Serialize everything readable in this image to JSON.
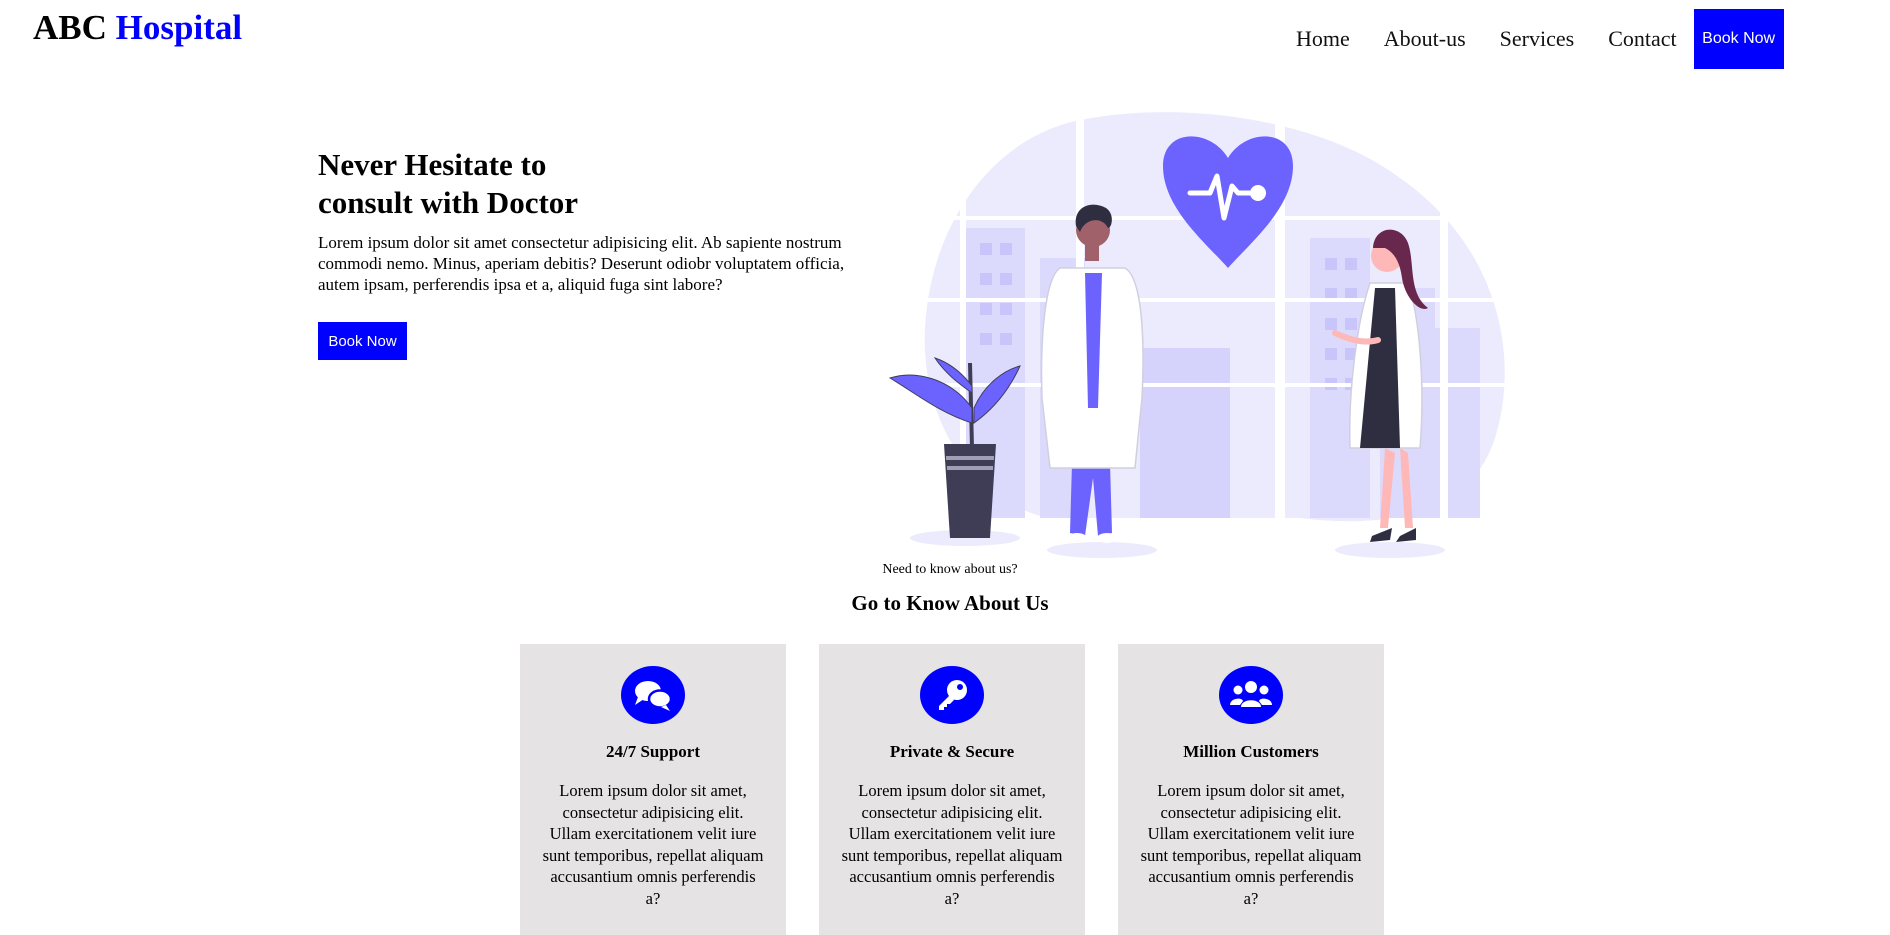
{
  "header": {
    "logo_main": "ABC",
    "logo_accent": "Hospital",
    "nav": [
      {
        "label": "Home"
      },
      {
        "label": "About-us"
      },
      {
        "label": "Services"
      },
      {
        "label": "Contact"
      }
    ],
    "book_label": "Book Now"
  },
  "hero": {
    "title": "Never Hesitate to consult with Doctor",
    "description": "Lorem ipsum dolor sit amet consectetur adipisicing elit. Ab sapiente nostrum commodi nemo. Minus, aperiam debitis? Deserunt odiobr voluptatem officia, autem ipsam, perferendis ipsa et a, aliquid fuga sint labore?",
    "button_label": "Book Now"
  },
  "about": {
    "kicker": "Need to know about us?",
    "title": "Go to Know About Us",
    "cards": [
      {
        "icon": "chat-bubbles-icon",
        "title": "24/7 Support",
        "text": "Lorem ipsum dolor sit amet, consectetur adipisicing elit. Ullam exercitationem velit iure sunt temporibus, repellat aliquam accusantium omnis perferendis a?"
      },
      {
        "icon": "key-icon",
        "title": "Private & Secure",
        "text": "Lorem ipsum dolor sit amet, consectetur adipisicing elit. Ullam exercitationem velit iure sunt temporibus, repellat aliquam accusantium omnis perferendis a?"
      },
      {
        "icon": "users-icon",
        "title": "Million Customers",
        "text": "Lorem ipsum dolor sit amet, consectetur adipisicing elit. Ullam exercitationem velit iure sunt temporibus, repellat aliquam accusantium omnis perferendis a?"
      }
    ]
  },
  "colors": {
    "brand": "#0000ff",
    "card_bg": "#e5e3e3",
    "illustration_accent": "#6c63ff"
  }
}
